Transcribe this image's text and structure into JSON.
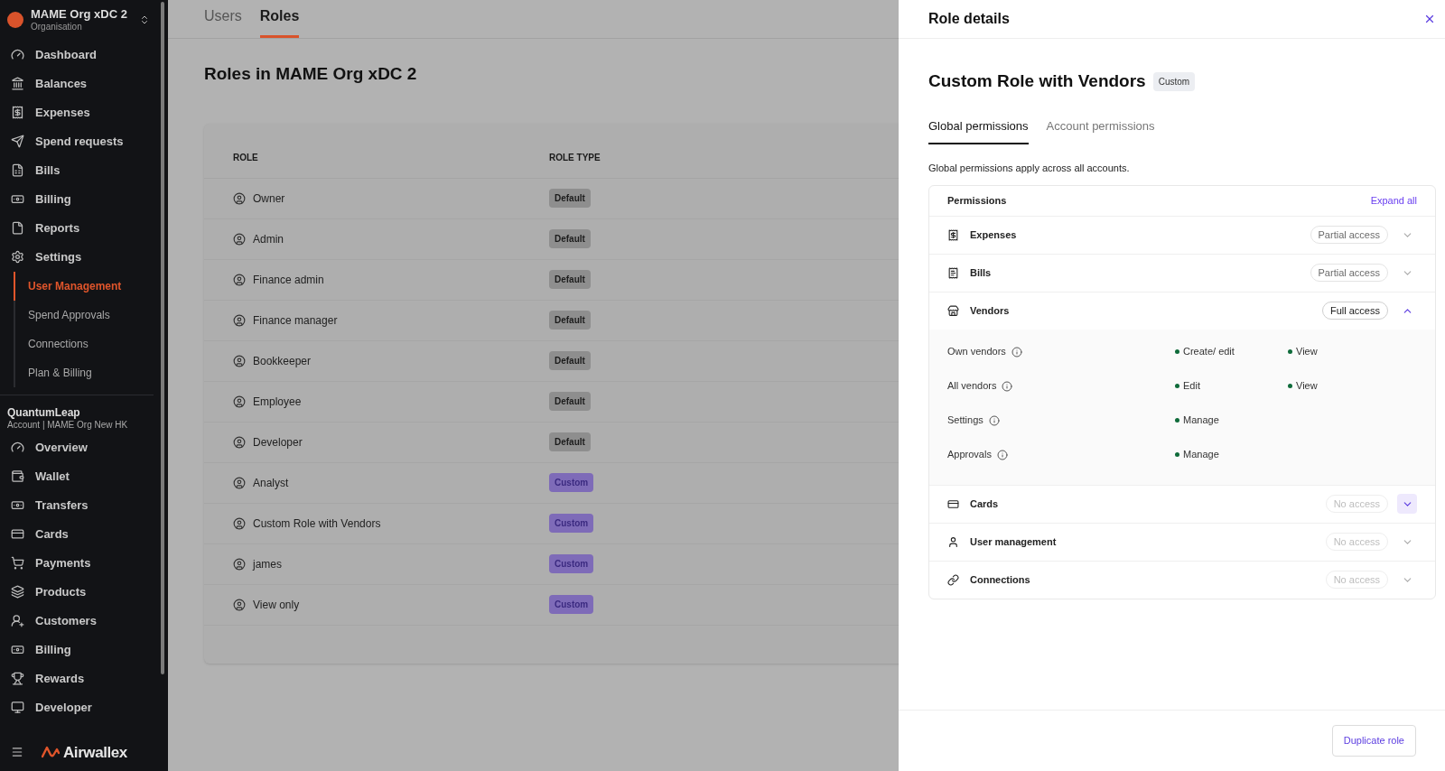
{
  "sidebar": {
    "org": {
      "name": "MAME Org xDC 2",
      "subtitle": "Organisation"
    },
    "items": [
      {
        "label": "Dashboard",
        "selected": false
      },
      {
        "label": "Balances",
        "selected": false
      },
      {
        "label": "Expenses",
        "selected": false
      },
      {
        "label": "Spend requests",
        "selected": false
      },
      {
        "label": "Bills",
        "selected": false
      },
      {
        "label": "Billing",
        "selected": false
      },
      {
        "label": "Reports",
        "selected": false
      },
      {
        "label": "Settings",
        "selected": false,
        "children": [
          {
            "label": "User Management",
            "selected": true
          },
          {
            "label": "Spend Approvals",
            "selected": false
          },
          {
            "label": "Connections",
            "selected": false
          },
          {
            "label": "Plan & Billing",
            "selected": false
          }
        ]
      }
    ],
    "account": {
      "name": "QuantumLeap",
      "subtitle": "Account | MAME Org New HK"
    },
    "account_items": [
      {
        "label": "Overview",
        "selected": false
      },
      {
        "label": "Wallet",
        "selected": false
      },
      {
        "label": "Transfers",
        "selected": false
      },
      {
        "label": "Cards",
        "selected": false
      },
      {
        "label": "Payments",
        "selected": false
      },
      {
        "label": "Products",
        "selected": false
      },
      {
        "label": "Customers",
        "selected": false
      },
      {
        "label": "Billing",
        "selected": false
      },
      {
        "label": "Rewards",
        "selected": false
      },
      {
        "label": "Developer",
        "selected": false
      }
    ],
    "logo": "Airwallex"
  },
  "tabs": [
    {
      "label": "Users",
      "selected": false
    },
    {
      "label": "Roles",
      "selected": true
    }
  ],
  "heading": "Roles in MAME Org xDC 2",
  "table": {
    "columns": [
      "ROLE",
      "ROLE TYPE"
    ],
    "rows": [
      {
        "name": "Owner",
        "type": "Default",
        "kind": "default"
      },
      {
        "name": "Admin",
        "type": "Default",
        "kind": "default"
      },
      {
        "name": "Finance admin",
        "type": "Default",
        "kind": "default"
      },
      {
        "name": "Finance manager",
        "type": "Default",
        "kind": "default"
      },
      {
        "name": "Bookkeeper",
        "type": "Default",
        "kind": "default"
      },
      {
        "name": "Employee",
        "type": "Default",
        "kind": "default"
      },
      {
        "name": "Developer",
        "type": "Default",
        "kind": "default"
      },
      {
        "name": "Analyst",
        "type": "Custom",
        "kind": "custom"
      },
      {
        "name": "Custom Role with Vendors",
        "type": "Custom",
        "kind": "custom"
      },
      {
        "name": "james",
        "type": "Custom",
        "kind": "custom"
      },
      {
        "name": "View only",
        "type": "Custom",
        "kind": "custom"
      }
    ]
  },
  "panel": {
    "title": "Role details",
    "role_name": "Custom Role with Vendors",
    "role_badge": "Custom",
    "tabs": [
      {
        "label": "Global permissions",
        "selected": true
      },
      {
        "label": "Account permissions",
        "selected": false
      }
    ],
    "description": "Global permissions apply across all accounts.",
    "permissions_header": "Permissions",
    "expand_all": "Expand all",
    "permissions": [
      {
        "name": "Expenses",
        "access": "Partial access",
        "kind": "partial",
        "expanded": false,
        "highlighted": false
      },
      {
        "name": "Bills",
        "access": "Partial access",
        "kind": "partial",
        "expanded": false,
        "highlighted": false
      },
      {
        "name": "Vendors",
        "access": "Full access",
        "kind": "full",
        "expanded": true,
        "highlighted": false,
        "details": [
          {
            "label": "Own vendors",
            "grants": [
              "Create/ edit",
              "View"
            ]
          },
          {
            "label": "All vendors",
            "grants": [
              "Edit",
              "View"
            ]
          },
          {
            "label": "Settings",
            "grants": [
              "Manage"
            ]
          },
          {
            "label": "Approvals",
            "grants": [
              "Manage"
            ]
          }
        ]
      },
      {
        "name": "Cards",
        "access": "No access",
        "kind": "none",
        "expanded": false,
        "highlighted": true
      },
      {
        "name": "User management",
        "access": "No access",
        "kind": "none",
        "expanded": false,
        "highlighted": false
      },
      {
        "name": "Connections",
        "access": "No access",
        "kind": "none",
        "expanded": false,
        "highlighted": false
      }
    ],
    "footer_button": "Duplicate role"
  }
}
